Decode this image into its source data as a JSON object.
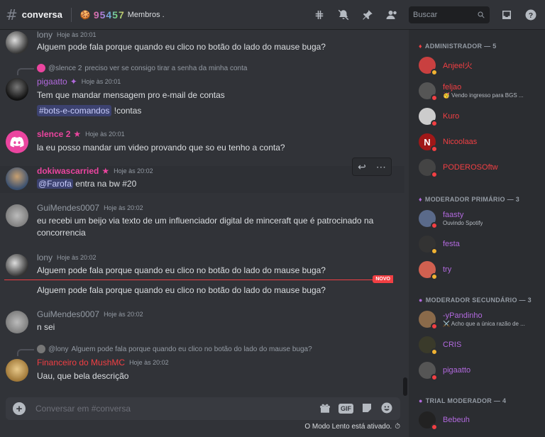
{
  "header": {
    "channel": "conversa",
    "topic_emoji": "🍪",
    "topic_count": "95457",
    "topic_label": "Membros .",
    "search_placeholder": "Buscar"
  },
  "chat": {
    "messages": [
      {
        "user": "lony",
        "color": "#949ba4",
        "time": "Hoje às 20:01",
        "text": "Alguem pode fala porque quando eu clico no botão do lado do mause  buga?"
      },
      {
        "reply_user": "@slence 2",
        "reply_text": "preciso ver se consigo tirar a senha da minha conta",
        "user": "pigaatto",
        "color": "#b169dd",
        "time": "Hoje às 20:01",
        "text1": "Tem que mandar mensagem pro e-mail de contas",
        "channel_mention": "#bots-e-comandos",
        "command": "!contas"
      },
      {
        "user": "slence 2",
        "color": "#eb459f",
        "time": "Hoje às 20:01",
        "text": "la eu posso mandar um video provando que so eu tenho a conta?"
      },
      {
        "user": "dokiwascarried",
        "color": "#eb459f",
        "time": "Hoje às 20:02",
        "mention": "@Farofa",
        "text": " entra na bw #20"
      },
      {
        "user": "GuiMendes0007",
        "color": "#949ba4",
        "time": "Hoje às 20:02",
        "text": "eu recebi um beijo via texto de um influenciador digital de minceraft que é patrocinado na concorrencia"
      },
      {
        "user": "lony",
        "color": "#949ba4",
        "time": "Hoje às 20:02",
        "text": "Alguem pode fala porque quando eu clico no botão do lado do mause  buga?",
        "text2": "Alguem pode fala porque quando eu clico no botão do lado do mause  buga?"
      },
      {
        "user": "GuiMendes0007",
        "color": "#949ba4",
        "time": "Hoje às 20:02",
        "text": "n sei"
      },
      {
        "reply_user": "@lony",
        "reply_text": "Alguem pode fala porque quando eu clico no botão do lado do mause buga?",
        "user": "Financeiro do MushMC",
        "color": "#f23f43",
        "time": "Hoje às 20:02",
        "text": "Uau, que bela descrição"
      }
    ],
    "new_label": "NOVO"
  },
  "input": {
    "placeholder": "Conversar em #conversa",
    "gif_label": "GIF",
    "slow_mode": "O Modo Lento está ativado."
  },
  "members": {
    "roles": [
      {
        "label": "ADMINISTRADOR — 5",
        "color": "#f23f43"
      },
      {
        "label": "MODERADOR PRIMÁRIO — 3",
        "color": "#b169dd"
      },
      {
        "label": "MODERADOR SECUNDÁRIO — 3",
        "color": "#b169dd"
      },
      {
        "label": "TRIAL MODERADOR — 4",
        "color": "#b169dd"
      }
    ],
    "list": [
      {
        "name": "Anjeel火",
        "color": "#f23f43",
        "sub": "",
        "status": "#f0b232"
      },
      {
        "name": "feljao",
        "color": "#f23f43",
        "sub": "🥳 Vendo ingresso para BGS ...",
        "status": "#f23f43"
      },
      {
        "name": "Kuro",
        "color": "#f23f43",
        "sub": "",
        "status": "#f23f43"
      },
      {
        "name": "Nicoolaas",
        "color": "#f23f43",
        "sub": "",
        "status": "#f23f43"
      },
      {
        "name": "PODEROSOftw",
        "color": "#f23f43",
        "sub": "",
        "status": "#f23f43"
      },
      {
        "name": "faasty",
        "color": "#b169dd",
        "sub": "Ouvindo Spotify",
        "status": "#f23f43"
      },
      {
        "name": "festa",
        "color": "#b169dd",
        "sub": "",
        "status": "#f0b232"
      },
      {
        "name": "try",
        "color": "#b169dd",
        "sub": "",
        "status": "#f0b232"
      },
      {
        "name": "-yPandinho",
        "color": "#b169dd",
        "sub": "⚔️ Acho que a única razão de ...",
        "status": "#f23f43"
      },
      {
        "name": "CRIS",
        "color": "#b169dd",
        "sub": "",
        "status": "#f0b232"
      },
      {
        "name": "pigaatto",
        "color": "#b169dd",
        "sub": "",
        "status": "#f23f43"
      },
      {
        "name": "Bebeuh",
        "color": "#b169dd",
        "sub": "",
        "status": "#f23f43"
      }
    ]
  }
}
